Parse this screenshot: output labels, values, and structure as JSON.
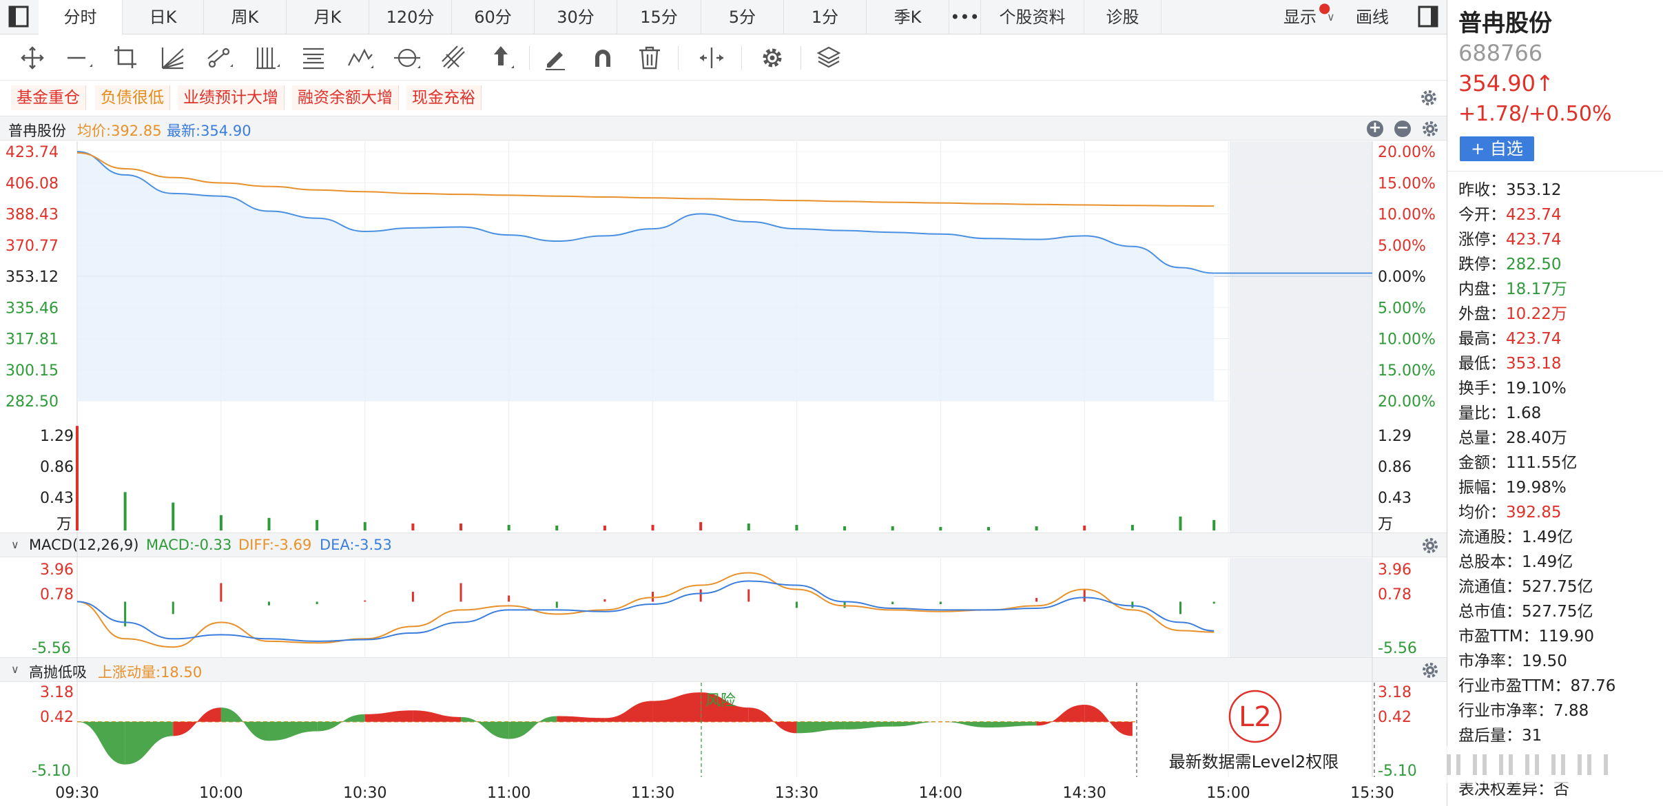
{
  "tabs": [
    "分时",
    "日K",
    "周K",
    "月K",
    "120分",
    "60分",
    "30分",
    "15分",
    "5分",
    "1分",
    "季K",
    "•••",
    "个股资料",
    "诊股"
  ],
  "active_tab": "分时",
  "top_right": {
    "display_label": "显示",
    "draw_label": "画线"
  },
  "tags": [
    {
      "label": "基金重仓",
      "color": "#e0302a"
    },
    {
      "label": "负债很低",
      "color": "#e58a1a"
    },
    {
      "label": "业绩预计大增",
      "color": "#e0302a"
    },
    {
      "label": "融资余额大增",
      "color": "#e0302a"
    },
    {
      "label": "现金充裕",
      "color": "#e0302a"
    }
  ],
  "price_header": {
    "name": "普冉股份",
    "avg_label": "均价:392.85",
    "latest_label": "最新:354.90"
  },
  "macd_header": {
    "title": "MACD(12,26,9)",
    "macd": "MACD:-0.33",
    "diff": "DIFF:-3.69",
    "dea": "DEA:-3.53"
  },
  "gpdx_header": {
    "title": "高抛低吸",
    "momentum": "上涨动量:18.50"
  },
  "gpdx_annotation": "风险",
  "level2": {
    "badge": "L2",
    "message": "最新数据需Level2权限"
  },
  "colors": {
    "up": "#e0302a",
    "down": "#2e9b38",
    "price_line": "#4a90e2",
    "avg_line": "#e8902a",
    "accent": "#3b7ddd"
  },
  "chart_data": [
    {
      "type": "line",
      "title": "普冉股份",
      "prev_close": 353.12,
      "ylim": [
        282.5,
        423.74
      ],
      "y_ticks": [
        "423.74",
        "406.08",
        "388.43",
        "370.77",
        "353.12",
        "335.46",
        "317.81",
        "300.15",
        "282.50"
      ],
      "pct_ticks": [
        "20.00%",
        "15.00%",
        "10.00%",
        "5.00%",
        "0.00%",
        "5.00%",
        "10.00%",
        "15.00%",
        "20.00%"
      ],
      "x_ticks": [
        "09:30",
        "10:00",
        "10:30",
        "11:00",
        "11:30",
        "13:30",
        "14:00",
        "14:30",
        "15:00",
        "15:30"
      ],
      "x": [
        "09:30",
        "09:40",
        "09:50",
        "10:00",
        "10:10",
        "10:20",
        "10:30",
        "10:40",
        "10:50",
        "11:00",
        "11:10",
        "11:20",
        "11:30",
        "13:10",
        "13:20",
        "13:30",
        "13:40",
        "13:50",
        "14:00",
        "14:10",
        "14:20",
        "14:30",
        "14:40",
        "14:50",
        "14:57"
      ],
      "series": [
        {
          "name": "最新",
          "values": [
            423.7,
            410.5,
            400.0,
            398.5,
            390.0,
            386.0,
            378.5,
            380.5,
            381.0,
            376.5,
            373.0,
            376.0,
            380.0,
            388.5,
            384.0,
            380.0,
            379.0,
            378.0,
            377.0,
            374.5,
            374.0,
            376.0,
            370.0,
            358.0,
            354.9
          ]
        },
        {
          "name": "均价",
          "values": [
            423.0,
            414.0,
            409.0,
            406.0,
            404.0,
            402.0,
            401.0,
            400.0,
            399.5,
            399.0,
            398.5,
            398.0,
            397.5,
            397.0,
            396.5,
            396.0,
            395.5,
            395.0,
            394.6,
            394.2,
            393.8,
            393.5,
            393.2,
            393.0,
            392.85
          ]
        }
      ]
    },
    {
      "type": "bar",
      "title": "成交量",
      "unit": "万",
      "y_ticks": [
        "1.29",
        "0.86",
        "0.43"
      ],
      "ylim": [
        0,
        1.72
      ],
      "x": [
        "09:30",
        "09:40",
        "09:50",
        "10:00",
        "10:10",
        "10:20",
        "10:30",
        "10:40",
        "10:50",
        "11:00",
        "11:10",
        "11:20",
        "11:30",
        "13:10",
        "13:20",
        "13:30",
        "13:40",
        "13:50",
        "14:00",
        "14:10",
        "14:20",
        "14:30",
        "14:40",
        "14:50",
        "14:57"
      ],
      "values": [
        1.5,
        0.55,
        0.4,
        0.22,
        0.18,
        0.15,
        0.12,
        0.1,
        0.1,
        0.08,
        0.07,
        0.07,
        0.08,
        0.12,
        0.1,
        0.08,
        0.06,
        0.06,
        0.05,
        0.05,
        0.06,
        0.07,
        0.08,
        0.2,
        0.15
      ]
    },
    {
      "type": "line",
      "title": "MACD(12,26,9)",
      "y_ticks": [
        "3.96",
        "0.78",
        "-5.56"
      ],
      "ylim": [
        -5.56,
        3.96
      ],
      "x": [
        "09:30",
        "09:40",
        "09:50",
        "10:00",
        "10:10",
        "10:20",
        "10:30",
        "10:40",
        "10:50",
        "11:00",
        "11:10",
        "11:20",
        "11:30",
        "13:10",
        "13:20",
        "13:30",
        "13:40",
        "13:50",
        "14:00",
        "14:10",
        "14:20",
        "14:30",
        "14:40",
        "14:50",
        "14:57"
      ],
      "series": [
        {
          "name": "DIFF",
          "values": [
            0.0,
            -4.5,
            -5.5,
            -2.5,
            -4.8,
            -5.0,
            -4.5,
            -3.0,
            -1.0,
            -0.5,
            -1.5,
            -1.0,
            0.5,
            2.0,
            3.5,
            1.5,
            -0.5,
            -1.0,
            -1.2,
            -1.0,
            -0.5,
            1.5,
            -1.0,
            -3.5,
            -3.69
          ]
        },
        {
          "name": "DEA",
          "values": [
            0.0,
            -2.5,
            -4.5,
            -4.0,
            -4.5,
            -4.8,
            -4.6,
            -3.8,
            -2.5,
            -1.0,
            -1.0,
            -1.2,
            -0.3,
            1.0,
            2.5,
            2.0,
            0.0,
            -0.8,
            -1.0,
            -1.0,
            -0.8,
            0.5,
            -0.5,
            -2.5,
            -3.53
          ]
        }
      ]
    },
    {
      "type": "area",
      "title": "高抛低吸",
      "y_ticks": [
        "3.18",
        "0.42",
        "-5.10"
      ],
      "ylim": [
        -5.1,
        3.18
      ],
      "reference": 0.0,
      "x": [
        "09:30",
        "09:40",
        "09:50",
        "10:00",
        "10:10",
        "10:20",
        "10:30",
        "10:40",
        "10:50",
        "11:00",
        "11:10",
        "11:20",
        "11:30",
        "13:10",
        "13:20",
        "13:30",
        "13:40",
        "13:50",
        "14:00",
        "14:10",
        "14:20",
        "14:30",
        "14:40"
      ],
      "values": [
        0.0,
        -4.5,
        -1.5,
        1.5,
        -2.0,
        -1.0,
        0.8,
        1.2,
        0.5,
        -1.8,
        0.6,
        0.4,
        2.2,
        3.1,
        1.5,
        -1.2,
        -0.8,
        -0.5,
        0.0,
        -0.6,
        -0.4,
        1.8,
        -1.5
      ]
    }
  ],
  "stock": {
    "name": "普冉股份",
    "code": "688766",
    "price": "354.90↑",
    "change": "+1.78/+0.50%",
    "fav_label": "+ 自选",
    "stats": [
      {
        "label": "昨收：",
        "value": "353.12",
        "color": "black"
      },
      {
        "label": "今开：",
        "value": "423.74",
        "color": "red"
      },
      {
        "label": "涨停：",
        "value": "423.74",
        "color": "red"
      },
      {
        "label": "跌停：",
        "value": "282.50",
        "color": "green"
      },
      {
        "label": "内盘：",
        "value": "18.17万",
        "color": "green"
      },
      {
        "label": "外盘：",
        "value": "10.22万",
        "color": "red"
      },
      {
        "label": "最高：",
        "value": "423.74",
        "color": "red"
      },
      {
        "label": "最低：",
        "value": "353.18",
        "color": "red"
      },
      {
        "label": "换手：",
        "value": "19.10%",
        "color": "black"
      },
      {
        "label": "量比：",
        "value": "1.68",
        "color": "black"
      },
      {
        "label": "总量：",
        "value": "28.40万",
        "color": "black"
      },
      {
        "label": "金额：",
        "value": "111.55亿",
        "color": "black"
      },
      {
        "label": "振幅：",
        "value": "19.98%",
        "color": "black"
      },
      {
        "label": "均价：",
        "value": "392.85",
        "color": "red"
      },
      {
        "label": "流通股：",
        "value": "1.49亿",
        "color": "black"
      },
      {
        "label": "总股本：",
        "value": "1.49亿",
        "color": "black"
      },
      {
        "label": "流通值：",
        "value": "527.75亿",
        "color": "black"
      },
      {
        "label": "总市值：",
        "value": "527.75亿",
        "color": "black"
      },
      {
        "label": "市盈TTM：",
        "value": "119.90",
        "color": "black"
      },
      {
        "label": "市净率：",
        "value": "19.50",
        "color": "black"
      },
      {
        "label": "行业市盈TTM：",
        "value": "87.76",
        "color": "black"
      },
      {
        "label": "行业市净率：",
        "value": "7.88",
        "color": "black"
      },
      {
        "label": "盘后量：",
        "value": "31",
        "color": "black"
      }
    ],
    "cut_stat": "表决权差异：否"
  }
}
